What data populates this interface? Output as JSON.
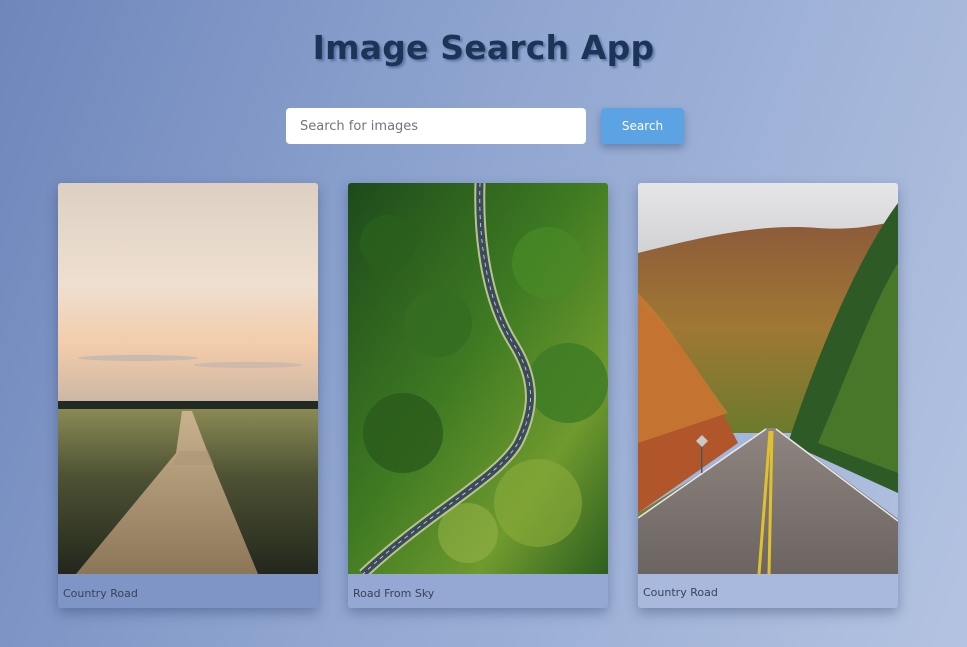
{
  "app": {
    "title": "Image Search App"
  },
  "search": {
    "placeholder": "Search for images",
    "value": "",
    "button_label": "Search"
  },
  "results": [
    {
      "caption": "Country Road"
    },
    {
      "caption": "Road From Sky"
    },
    {
      "caption": "Country Road"
    }
  ],
  "colors": {
    "title": "#1c3556",
    "button": "#5ba3e3"
  }
}
